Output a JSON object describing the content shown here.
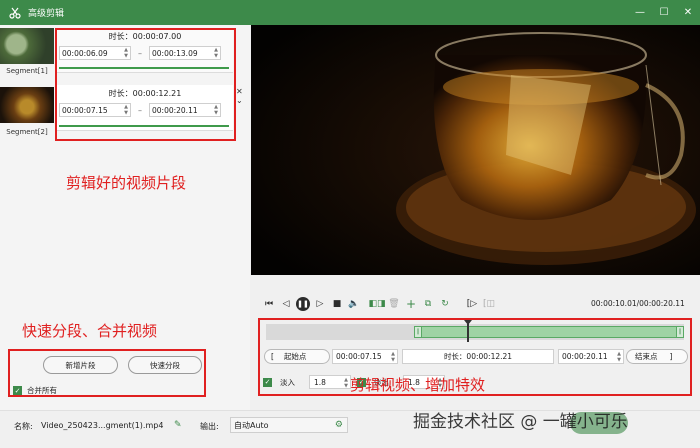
{
  "window": {
    "title": "高级剪辑",
    "app_icon": "scissors-icon",
    "minimize_icon": "minimize-icon",
    "maximize_icon": "maximize-icon",
    "close_icon": "close-icon"
  },
  "segments": {
    "items": [
      {
        "label": "Segment[1]",
        "duration": "时长：00:00:07.00",
        "start": "00:00:06.09",
        "end": "00:00:13.09"
      },
      {
        "label": "Segment[2]",
        "duration": "时长：00:00:12.21",
        "start": "00:00:07.15",
        "end": "00:00:20.11"
      }
    ],
    "separator": "–"
  },
  "annotations": {
    "segments_note": "剪辑好的视频片段",
    "split_note": "快速分段、合并视频",
    "edit_note": "剪辑视频、增加特效"
  },
  "left_actions": {
    "new_segment": "新增片段",
    "quick_split": "快速分段",
    "merge_all": "合并所有",
    "merge_all_checked": true
  },
  "player": {
    "current_time": "00:00:10.01",
    "total_time": "00:00:20.11",
    "time_separator": "/",
    "controls": [
      "go-start-icon",
      "prev-frame-icon",
      "pause-icon",
      "next-frame-icon",
      "stop-icon",
      "volume-icon",
      "split-icon",
      "delete-icon",
      "add-icon",
      "copy-icon",
      "rotate-icon",
      "mark-in-icon",
      "mark-out-icon"
    ]
  },
  "timeline": {
    "selection_start_fraction": 0.354,
    "selection_end_fraction": 1.0,
    "playhead_fraction": 0.483
  },
  "range": {
    "start_button": "起始点",
    "start_time": "00:00:07.15",
    "duration": "时长：00:00:12.21",
    "end_time": "00:00:20.11",
    "end_button": "结束点",
    "left_bracket": "[",
    "right_bracket": "]"
  },
  "effects": {
    "fade_in_label": "淡入",
    "fade_in_value": "1.8",
    "fade_in_checked": true,
    "fade_out_label": "淡出",
    "fade_out_value": "1.8",
    "fade_out_checked": true
  },
  "output": {
    "name_label": "名称:",
    "name_value": "Video_250423...gment(1).mp4",
    "output_label": "输出:",
    "output_value": "自动Auto"
  },
  "watermark": "掘金技术社区 @ 一罐小可乐",
  "colors": {
    "accent": "#3d8a4a",
    "annotation": "#e02020"
  }
}
